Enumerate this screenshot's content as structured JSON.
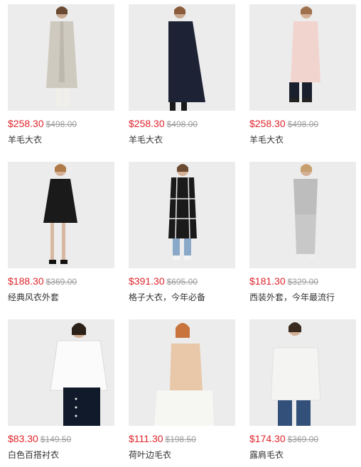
{
  "products": [
    {
      "price": "$258.30",
      "old_price": "$498.00",
      "name": "羊毛大衣"
    },
    {
      "price": "$258.30",
      "old_price": "$498.00",
      "name": "羊毛大衣"
    },
    {
      "price": "$258.30",
      "old_price": "$498.00",
      "name": "羊毛大衣"
    },
    {
      "price": "$188.30",
      "old_price": "$369.00",
      "name": "经典风衣外套"
    },
    {
      "price": "$391.30",
      "old_price": "$695.00",
      "name": "格子大衣，今年必备"
    },
    {
      "price": "$181.30",
      "old_price": "$329.00",
      "name": "西装外套，今年最流行"
    },
    {
      "price": "$83.30",
      "old_price": "$149.50",
      "name": "白色百搭衬衣"
    },
    {
      "price": "$111.30",
      "old_price": "$198.50",
      "name": "荷叶边毛衣"
    },
    {
      "price": "$174.30",
      "old_price": "$369.00",
      "name": "露肩毛衣"
    }
  ]
}
